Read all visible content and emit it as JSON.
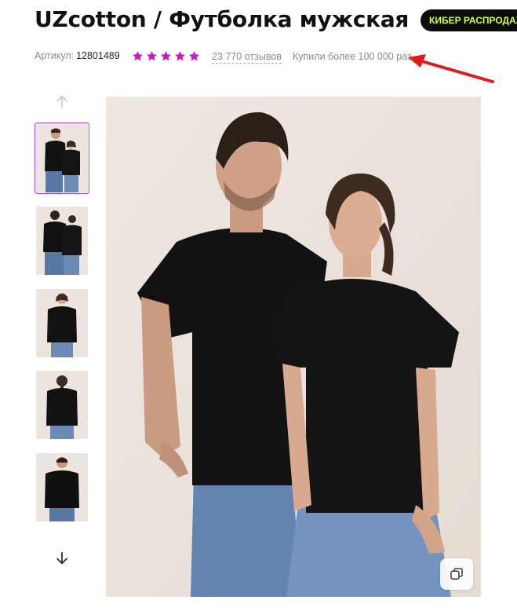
{
  "product": {
    "title": "UZcotton / Футболка мужская",
    "badge": "КИБЕР РАСПРОДАЖ",
    "sku_label": "Артикул:",
    "sku_value": "12801489",
    "rating_stars": 5,
    "reviews": "23 770 отзывов",
    "bought": "Купили более 100 000 раз"
  },
  "colors": {
    "accent_star": "#c61fb4",
    "thumb_active_border": "#a33be0",
    "badge_bg": "#0c0c0c",
    "badge_text": "#d4ff3a",
    "annotation_arrow": "#e41a1a"
  },
  "gallery": {
    "thumbnails": [
      {
        "subject": "man-and-woman-front",
        "active": true
      },
      {
        "subject": "man-and-woman-back",
        "active": false
      },
      {
        "subject": "woman-front",
        "active": false
      },
      {
        "subject": "woman-back",
        "active": false
      },
      {
        "subject": "man-front",
        "active": false
      }
    ],
    "icons": {
      "up": "arrow-up-icon",
      "down": "arrow-down-icon",
      "copy": "copy-icon"
    }
  }
}
